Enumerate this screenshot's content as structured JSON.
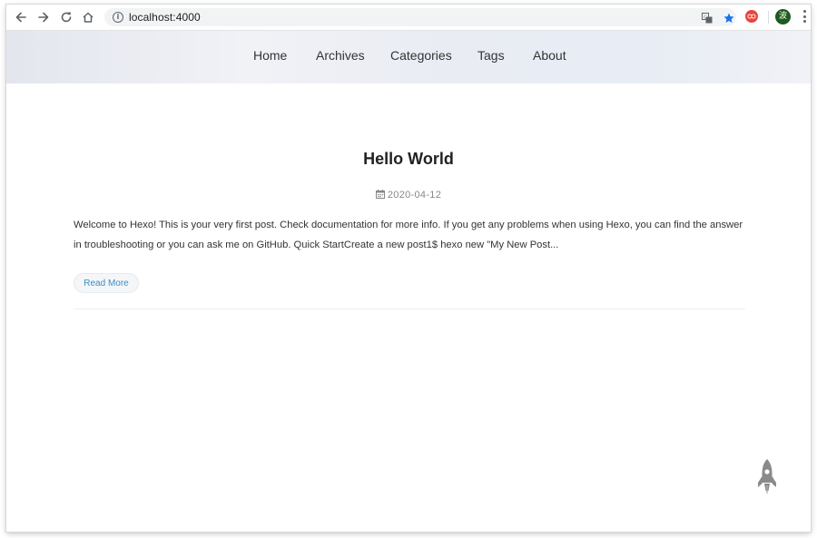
{
  "browser": {
    "url": "localhost:4000",
    "avatar_letter": "波"
  },
  "site": {
    "nav": [
      {
        "label": "Home"
      },
      {
        "label": "Archives"
      },
      {
        "label": "Categories"
      },
      {
        "label": "Tags"
      },
      {
        "label": "About"
      }
    ]
  },
  "post": {
    "title": "Hello World",
    "date": "2020-04-12",
    "excerpt": "Welcome to Hexo! This is your very first post. Check documentation for more info. If you get any problems when using Hexo, you can find the answer in troubleshooting or you can ask me on GitHub. Quick StartCreate a new post1$ hexo new \"My New Post...",
    "read_more": "Read More"
  },
  "icons": {
    "back": "arrow-left-icon",
    "forward": "arrow-right-icon",
    "reload": "reload-icon",
    "home": "home-icon",
    "info": "info-icon",
    "translate": "translate-icon",
    "bookmark": "star-icon",
    "extension": "extension-icon",
    "menu": "kebab-menu-icon",
    "date": "calendar-icon",
    "back_to_top": "rocket-icon"
  },
  "colors": {
    "accent_link": "#3d8fc6",
    "star": "#1a73e8",
    "extension": "#e8453c",
    "avatar_bg": "#1e5b1e"
  }
}
